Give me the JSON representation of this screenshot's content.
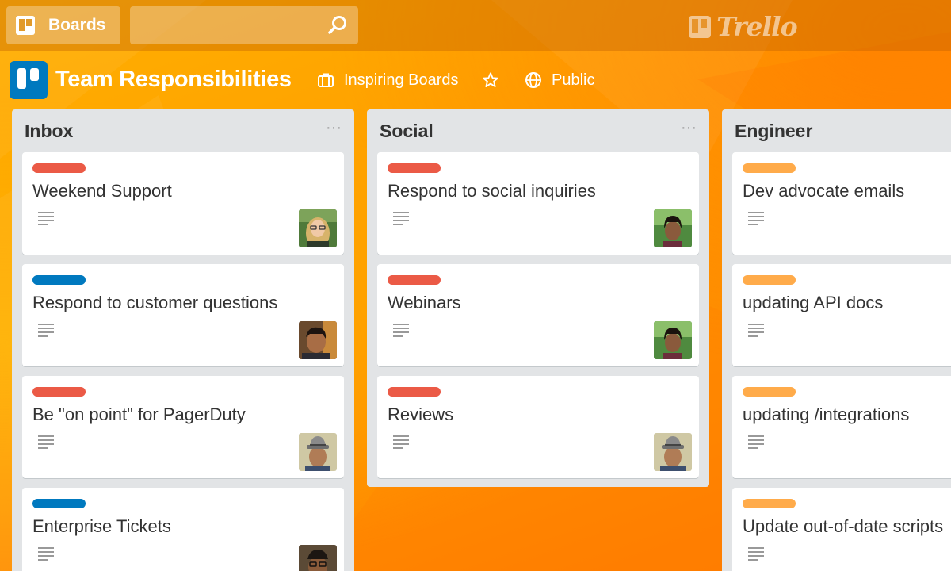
{
  "header": {
    "boards_label": "Boards",
    "search_placeholder": "",
    "brand": "Trello"
  },
  "board": {
    "title": "Team Responsibilities",
    "team": "Inspiring Boards",
    "visibility": "Public"
  },
  "label_colors": {
    "red": "#eb5a46",
    "blue": "#0079bf",
    "orange": "#ffab4a"
  },
  "lists": [
    {
      "title": "Inbox",
      "menu": "···",
      "cards": [
        {
          "title": "Weekend Support",
          "label": "red",
          "avatar": "avatar-woman-glasses"
        },
        {
          "title": "Respond to customer questions",
          "label": "blue",
          "avatar": "avatar-man-dark-hair"
        },
        {
          "title": "Be \"on point\" for PagerDuty",
          "label": "red",
          "avatar": "avatar-man-hat"
        },
        {
          "title": "Enterprise Tickets",
          "label": "blue",
          "avatar": "avatar-man-glasses"
        }
      ]
    },
    {
      "title": "Social",
      "menu": "···",
      "cards": [
        {
          "title": "Respond to social inquiries",
          "label": "red",
          "avatar": "avatar-woman-outdoors"
        },
        {
          "title": "Webinars",
          "label": "red",
          "avatar": "avatar-woman-outdoors"
        },
        {
          "title": "Reviews",
          "label": "red",
          "avatar": "avatar-man-hat"
        }
      ]
    },
    {
      "title": "Engineer",
      "menu": "···",
      "cards": [
        {
          "title": "Dev advocate emails",
          "label": "orange"
        },
        {
          "title": "updating API docs",
          "label": "orange"
        },
        {
          "title": "updating /integrations",
          "label": "orange"
        },
        {
          "title": "Update out-of-date scripts",
          "label": "orange"
        }
      ]
    }
  ]
}
